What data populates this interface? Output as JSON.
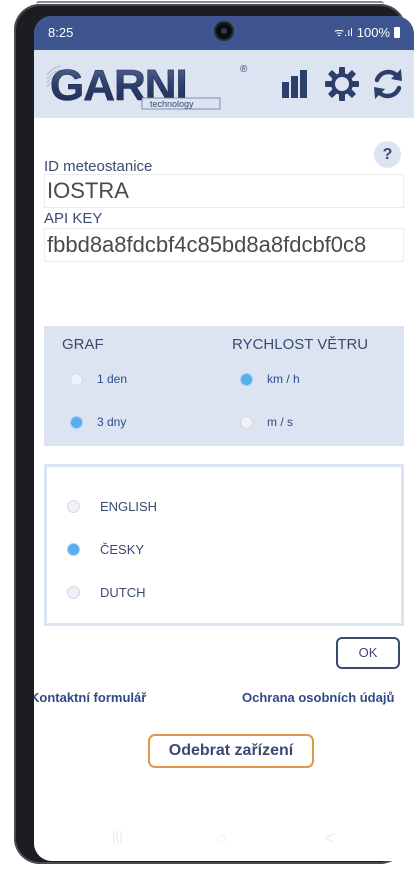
{
  "status_bar": {
    "time": "8:25",
    "signal": "ᯤ.ıl",
    "battery": "100%"
  },
  "header": {
    "logo_text": "GARNI",
    "logo_sub": "technology",
    "logo_mark": "®",
    "icons": [
      "chart-icon",
      "gear-icon",
      "refresh-icon"
    ]
  },
  "form": {
    "station_id_label": "ID meteostanice",
    "station_id_value": "IOSTRA",
    "api_key_label": "API KEY",
    "api_key_value": "fbbd8a8fdcbf4c85bd8a8fdcbf0c8",
    "help_label": "?"
  },
  "settings": {
    "graph": {
      "title": "GRAF",
      "options": [
        {
          "label": "1 den",
          "selected": false
        },
        {
          "label": "3 dny",
          "selected": true
        }
      ]
    },
    "wind": {
      "title": "RYCHLOST VĚTRU",
      "options": [
        {
          "label": "km / h",
          "selected": true
        },
        {
          "label": "m / s",
          "selected": false
        }
      ]
    }
  },
  "language": {
    "options": [
      {
        "label": "ENGLISH",
        "selected": false
      },
      {
        "label": "ČESKY",
        "selected": true
      },
      {
        "label": "DUTCH",
        "selected": false
      }
    ]
  },
  "actions": {
    "ok_label": "OK",
    "contact_link": "Kontaktní formulář",
    "privacy_link": "Ochrana osobních údajů",
    "remove_device_label": "Odebrat zařízení"
  },
  "navbar": {
    "recent": "|||",
    "home": "○",
    "back": "<"
  },
  "colors": {
    "accent": "#3e5590",
    "panel": "#dde4f1",
    "radio_selected": "#5aaef0",
    "remove_border": "#e1964a"
  }
}
